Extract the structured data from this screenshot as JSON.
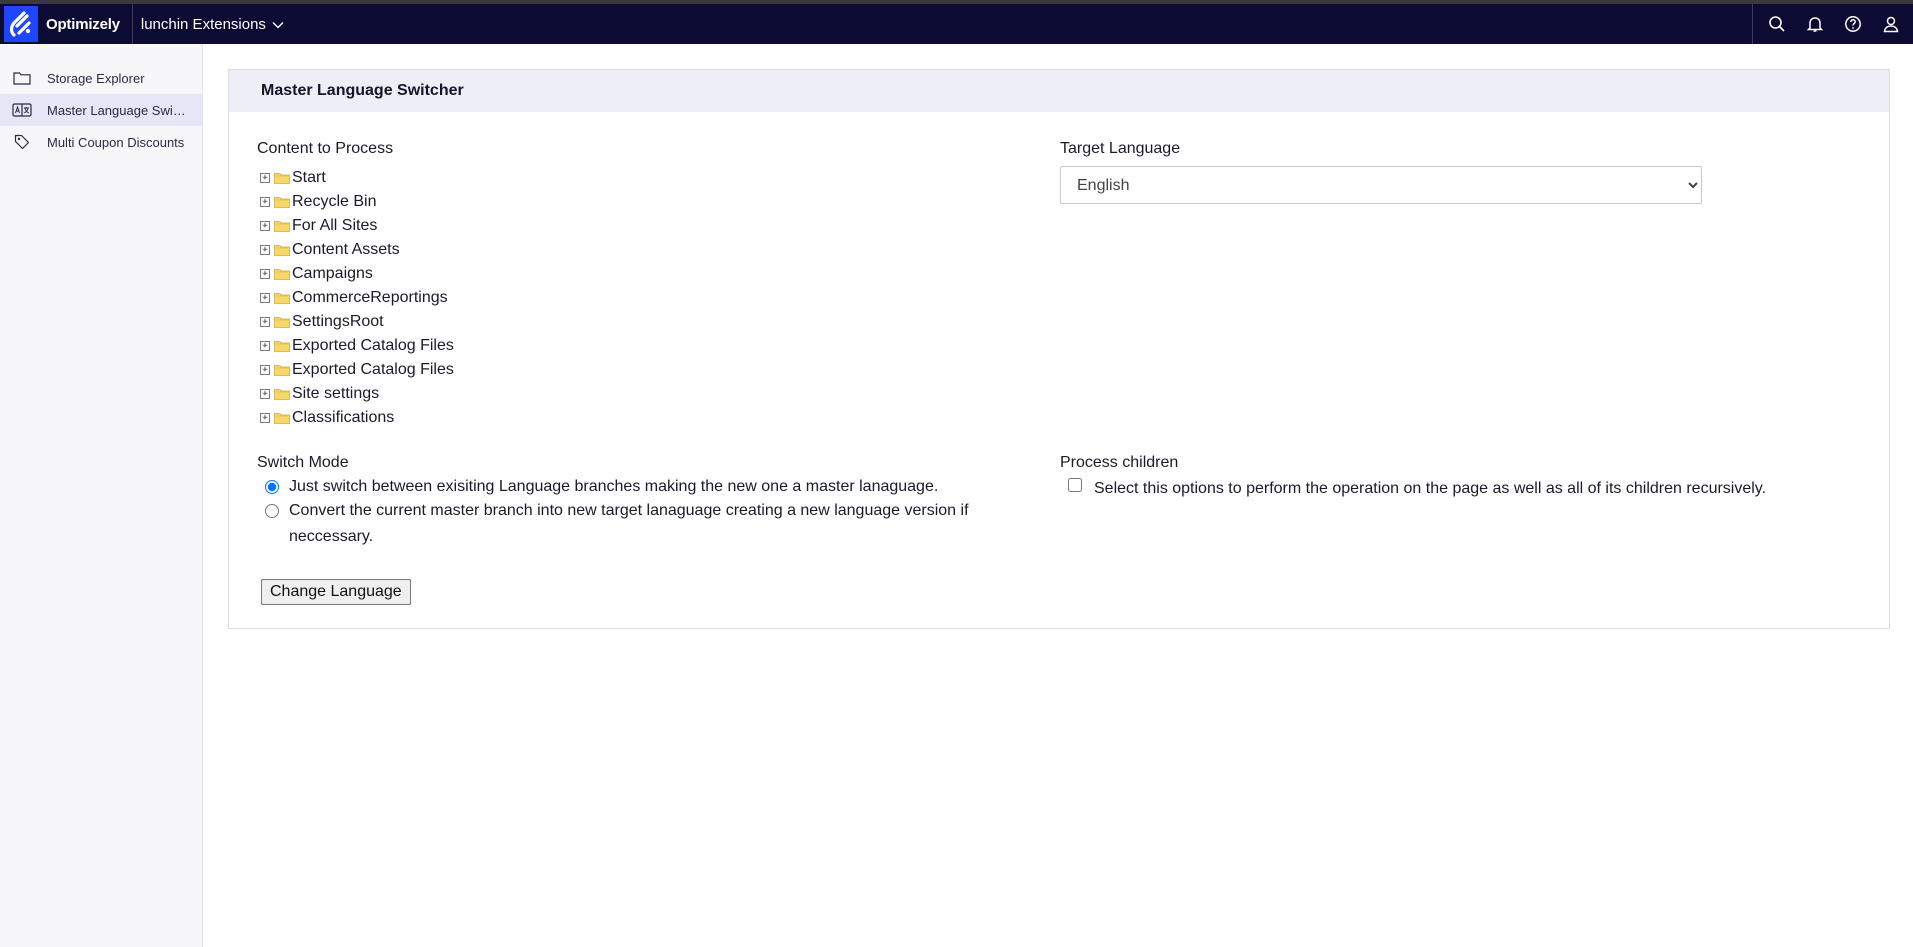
{
  "topbar": {
    "brand": "Optimizely",
    "app_name": "lunchin Extensions",
    "icons": [
      "search-icon",
      "bell-icon",
      "help-icon",
      "user-icon"
    ]
  },
  "sidebar": {
    "items": [
      {
        "label": "Storage Explorer",
        "icon": "folder-icon",
        "active": false
      },
      {
        "label": "Master Language Switcher",
        "icon": "language-icon",
        "active": true
      },
      {
        "label": "Multi Coupon Discounts",
        "icon": "tag-icon",
        "active": false
      }
    ]
  },
  "panel": {
    "title": "Master Language Switcher",
    "content_label": "Content to Process",
    "tree": [
      "Start",
      "Recycle Bin",
      "For All Sites",
      "Content Assets",
      "Campaigns",
      "CommerceReportings",
      "SettingsRoot",
      "Exported Catalog Files",
      "Exported Catalog Files",
      "Site settings",
      "Classifications"
    ],
    "target_label": "Target Language",
    "target_value": "English",
    "switch_mode_label": "Switch Mode",
    "mode_options": [
      "Just switch between exisiting Language branches making the new one a master lanaguage.",
      "Convert the current master branch into new target lanaguage creating a new language version if neccessary."
    ],
    "process_children_label": "Process children",
    "process_children_text": "Select this options to perform the operation on the page as well as all of its children recursively.",
    "button_label": "Change Language"
  },
  "colors": {
    "topbar_bg": "#0b0b33",
    "brand_blue": "#1f45ff",
    "sidebar_active": "#e6e6f6",
    "panel_header_bg": "#eeeff6"
  }
}
